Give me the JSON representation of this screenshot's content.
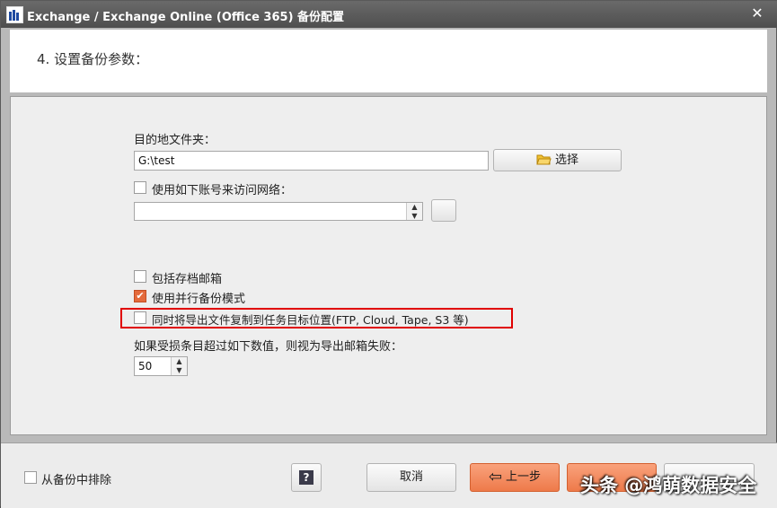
{
  "window": {
    "title": "Exchange / Exchange Online (Office 365) 备份配置",
    "close_glyph": "✕"
  },
  "header": {
    "step_title": "4. 设置备份参数："
  },
  "destination": {
    "label": "目的地文件夹：",
    "path_value": "G:\\test",
    "browse_label": "选择",
    "browse_icon": "folder-icon"
  },
  "network": {
    "checkbox_label": "使用如下账号来访问网络：",
    "checked": false,
    "account_value": "",
    "extra_button_label": ""
  },
  "options": [
    {
      "label": "包括存档邮箱",
      "checked": false
    },
    {
      "label": "使用并行备份模式",
      "checked": true
    },
    {
      "label": "同时将导出文件复制到任务目标位置(FTP, Cloud, Tape, S3 等)",
      "checked": false
    }
  ],
  "threshold": {
    "label": "如果受损条目超过如下数值，则视为导出邮箱失败：",
    "value": "50"
  },
  "footer": {
    "exclude_label": "从备份中排除",
    "exclude_checked": false,
    "help_label": "?",
    "cancel_label": "取消",
    "back_label": "上一步",
    "next_label": "",
    "finish_label": ""
  },
  "watermark": "头条 @鸿萌数据安全",
  "colors": {
    "accent_orange": "#ee7a4a",
    "highlight_red": "#e00000",
    "titlebar": "#555555"
  }
}
